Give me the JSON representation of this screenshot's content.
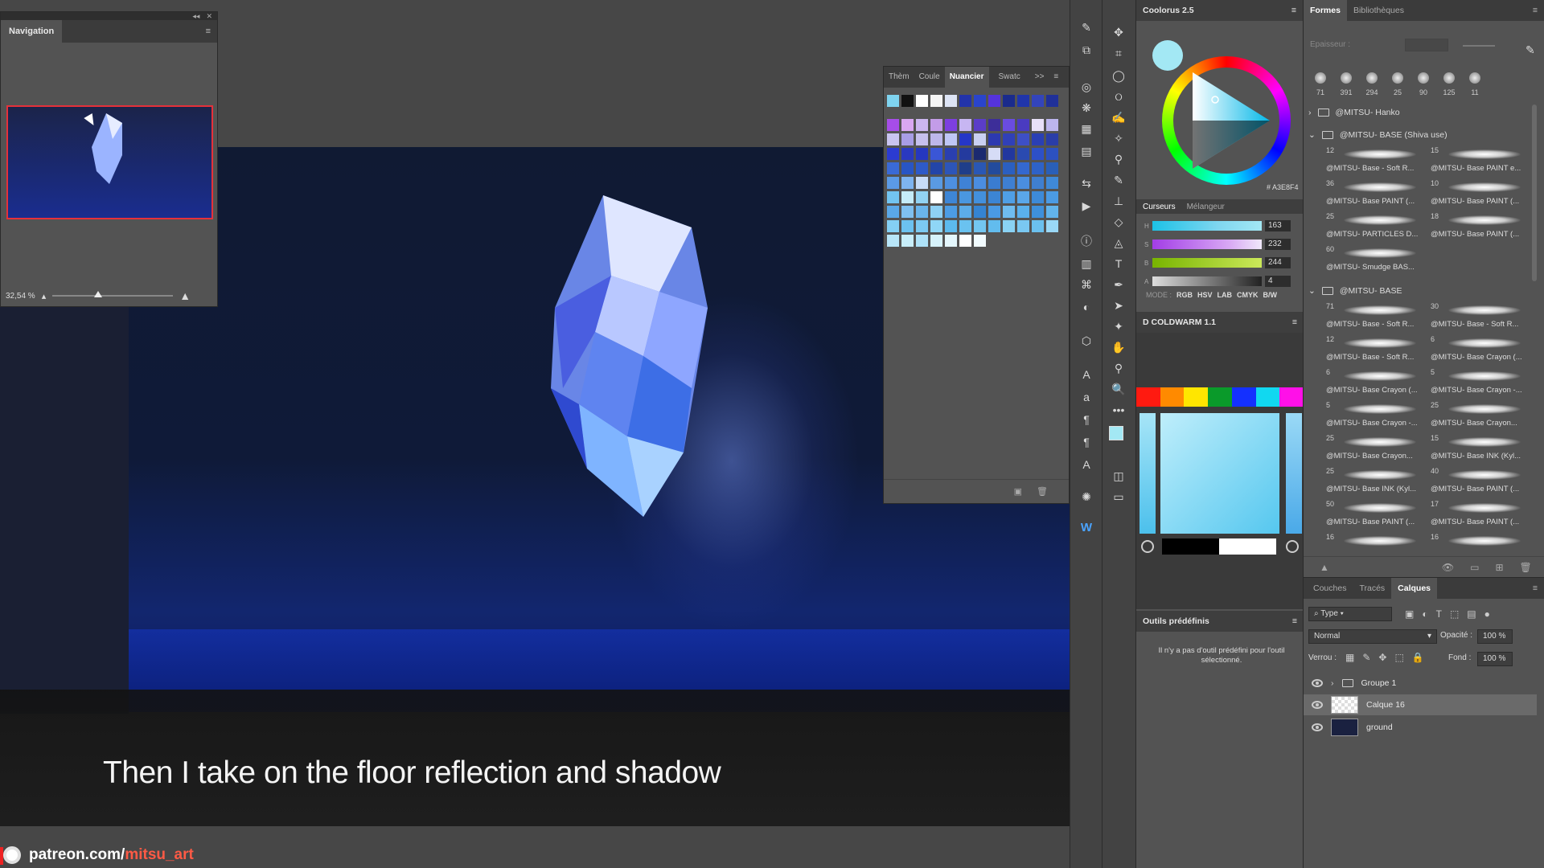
{
  "navigator": {
    "title": "Navigation",
    "zoom": "32,54 %"
  },
  "swatches": {
    "tabs": [
      "Thèm",
      "Coule",
      "Nuancier",
      "Swatc"
    ],
    "active_tab": "Nuancier",
    "more": ">>",
    "top_row": [
      "#7fd4f0",
      "#111111",
      "#ffffff",
      "#f5f5f5",
      "#dde4f5",
      "#2233aa",
      "#2a44cc",
      "#5533dd",
      "#1a2b8c",
      "#2035aa",
      "#3344bb",
      "#203099"
    ],
    "grid": [
      [
        "#a64de8",
        "#d9a7f2",
        "#cbb6f0",
        "#c39ce8",
        "#7d3fe0",
        "#c7b6f2",
        "#5b3dc8",
        "#3d2e99",
        "#6a4ce0",
        "#4a3bc0",
        "#e8e0f8",
        "#bcb5ee"
      ],
      [
        "#c9c4f0",
        "#a89de6",
        "#c6c0ee",
        "#bdb7ea",
        "#bfc6f5",
        "#2536c8",
        "#c9d0f2",
        "#2c39b0",
        "#3040b8",
        "#3d4fc6",
        "#2a3fb4",
        "#2a3da8"
      ],
      [
        "#2b3bd2",
        "#2a39c0",
        "#2537c0",
        "#3a56d6",
        "#2a3fb0",
        "#243a9e",
        "#1b2a70",
        "#d6dcf6",
        "#22379e",
        "#2a4ab0",
        "#2d50c8",
        "#2c51c0"
      ],
      [
        "#3a6ad6",
        "#2855c4",
        "#2e5ac8",
        "#2345a8",
        "#2d55b8",
        "#1f3e8a",
        "#2a57b4",
        "#234b9c",
        "#2b5fc0",
        "#3468d0",
        "#2e62c8",
        "#2a5fb8"
      ],
      [
        "#5b9ae6",
        "#7eb4f0",
        "#c7dcf8",
        "#5a9ae2",
        "#4d8fe0",
        "#3f82d6",
        "#4b8de0",
        "#3a7cd0",
        "#3e7fd2",
        "#4a8ee0",
        "#3f7fd0",
        "#3f89d8"
      ],
      [
        "#72c4f0",
        "#c5ecf9",
        "#92d3f3",
        "#ffffff",
        "#3e86d6",
        "#4a97e0",
        "#4390dc",
        "#3c85d4",
        "#4f9fe6",
        "#5aa7ea",
        "#3d8ad8",
        "#4b9be4"
      ],
      [
        "#5aa8e8",
        "#7fc0f0",
        "#6ab5ec",
        "#8ed0f4",
        "#4c9ce4",
        "#5cace8",
        "#3584d2",
        "#4a9ae4",
        "#6fbcf0",
        "#5ab0ec",
        "#3e90dc",
        "#62b4ec"
      ],
      [
        "#84d0f4",
        "#6cc2f0",
        "#7ccaf2",
        "#8fd6f6",
        "#5cbaee",
        "#6ac2f0",
        "#73c6f0",
        "#62bcee",
        "#8ad2f4",
        "#7ac8f2",
        "#6bc0ee",
        "#9ad8f6"
      ],
      [
        "#b8e6f8",
        "#c8eefa",
        "#aee2f8",
        "#d6f2fb",
        "#e4f6fc",
        "#ffffff",
        "#f2fbfe"
      ]
    ]
  },
  "coolorus": {
    "title": "Coolorus 2.5",
    "hex": "# A3E8F4",
    "tabs": [
      "Curseurs",
      "Mélangeur"
    ],
    "sliders": [
      {
        "label": "H",
        "value": "163"
      },
      {
        "label": "S",
        "value": "232"
      },
      {
        "label": "B",
        "value": "244"
      },
      {
        "label": "A",
        "value": "4"
      }
    ],
    "mode_label": "MODE :",
    "modes": [
      "RGB",
      "HSV",
      "LAB",
      "CMYK",
      "B/W"
    ]
  },
  "coldwarm": {
    "title": "D COLDWARM 1.1",
    "hues": [
      "#ff1a10",
      "#ff8a00",
      "#ffe600",
      "#0a9a2a",
      "#1430ff",
      "#11d8f0",
      "#ff10e8"
    ]
  },
  "outils": {
    "title": "Outils prédéfinis",
    "message": "Il n'y a pas d'outil prédéfini pour l'outil sélectionné."
  },
  "formes": {
    "tabs": [
      "Formes",
      "Bibliothèques"
    ],
    "epaisseur": "Epaisseur :",
    "recent_sizes": [
      "71",
      "391",
      "294",
      "25",
      "90",
      "125",
      "11"
    ],
    "groups": [
      {
        "name": "@MITSU- Hanko",
        "expanded": false
      },
      {
        "name": "@MITSU- BASE (Shiva use)",
        "expanded": true
      },
      {
        "name": "@MITSU- BASE",
        "expanded": true
      }
    ],
    "brushes_group1": [
      {
        "size": "12",
        "name": "@MITSU- Base - Soft R..."
      },
      {
        "size": "15",
        "name": "@MITSU- Base PAINT e..."
      },
      {
        "size": "36",
        "name": "@MITSU- Base PAINT (..."
      },
      {
        "size": "10",
        "name": "@MITSU- Base PAINT (..."
      },
      {
        "size": "25",
        "name": "@MITSU- PARTICLES D..."
      },
      {
        "size": "18",
        "name": "@MITSU- Base PAINT (..."
      },
      {
        "size": "60",
        "name": "@MITSU- Smudge BAS..."
      }
    ],
    "brushes_group2": [
      {
        "size": "71",
        "name": "@MITSU- Base - Soft R..."
      },
      {
        "size": "30",
        "name": "@MITSU- Base - Soft R..."
      },
      {
        "size": "12",
        "name": "@MITSU- Base - Soft R..."
      },
      {
        "size": "6",
        "name": "@MITSU- Base Crayon (..."
      },
      {
        "size": "6",
        "name": "@MITSU- Base Crayon (..."
      },
      {
        "size": "5",
        "name": "@MITSU- Base Crayon -..."
      },
      {
        "size": "5",
        "name": "@MITSU- Base Crayon -..."
      },
      {
        "size": "25",
        "name": "@MITSU- Base Crayon..."
      },
      {
        "size": "25",
        "name": "@MITSU- Base Crayon..."
      },
      {
        "size": "15",
        "name": "@MITSU- Base INK (Kyl..."
      },
      {
        "size": "25",
        "name": "@MITSU- Base INK (Kyl..."
      },
      {
        "size": "40",
        "name": "@MITSU- Base PAINT (..."
      },
      {
        "size": "50",
        "name": "@MITSU- Base PAINT (..."
      },
      {
        "size": "17",
        "name": "@MITSU- Base PAINT (..."
      },
      {
        "size": "16",
        "name": ""
      },
      {
        "size": "16",
        "name": ""
      }
    ]
  },
  "calques": {
    "tabs": [
      "Couches",
      "Tracés",
      "Calques"
    ],
    "active_tab": "Calques",
    "filter": "Type",
    "blend_mode": "Normal",
    "opacity_label": "Opacité :",
    "opacity": "100 %",
    "lock_label": "Verrou :",
    "fill_label": "Fond :",
    "fill": "100 %",
    "layers": [
      {
        "name": "Groupe 1",
        "type": "group",
        "selected": false
      },
      {
        "name": "Calque 16",
        "type": "layer",
        "selected": true
      },
      {
        "name": "ground",
        "type": "layer",
        "selected": false
      }
    ]
  },
  "subtitle": "Then I take on the floor reflection and shadow",
  "watermark": {
    "prefix": "patreon.com/",
    "handle": "mitsu_art"
  }
}
